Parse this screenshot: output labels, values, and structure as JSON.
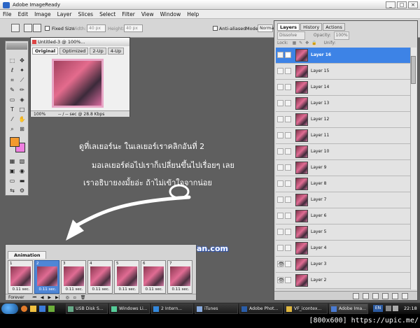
{
  "window": {
    "title": "Adobe ImageReady"
  },
  "menu": [
    "File",
    "Edit",
    "Image",
    "Layer",
    "Slices",
    "Select",
    "Filter",
    "View",
    "Window",
    "Help"
  ],
  "options": {
    "fixed_size": "Fixed Size",
    "width_label": "Width:",
    "width_value": "40 px",
    "height_label": "Height:",
    "height_value": "40 px",
    "anti_aliased": "Anti-aliased",
    "mode_label": "Mode:",
    "mode_value": "Norma"
  },
  "document": {
    "title": "Untitled-3 @ 100%...",
    "tabs": [
      "Original",
      "Optimized",
      "2-Up",
      "4-Up"
    ],
    "zoom": "100%",
    "status": "-- / -- sec @ 28.8 Kbps"
  },
  "caption": {
    "line1": "ดูที่เลเยอร์นะ ในเลเยอร์เราคลิกอันที่ 2",
    "line2": "มอเลเยอร์ต่อไปเราก็เปลี่ยนขึ้นไปเรื่อยๆ เลย",
    "line3": "เราอธิบายงงมั้ยอ่ะ ถ้าไม่เข้าใจจากน่อย",
    "credit": "Credit P_Ploy www.fourfan.com"
  },
  "animation": {
    "tab": "Animation",
    "frames": [
      {
        "num": "1",
        "delay": "0.11 sec.",
        "selected": false
      },
      {
        "num": "2",
        "delay": "0.11 sec.",
        "selected": true
      },
      {
        "num": "3",
        "delay": "0.11 sec.",
        "selected": false
      },
      {
        "num": "4",
        "delay": "0.11 sec.",
        "selected": false
      },
      {
        "num": "5",
        "delay": "0.11 sec.",
        "selected": false
      },
      {
        "num": "6",
        "delay": "0.11 sec.",
        "selected": false
      },
      {
        "num": "7",
        "delay": "0.11 sec.",
        "selected": false
      }
    ],
    "loop": "Forever"
  },
  "layers_panel": {
    "tabs": [
      "Layers",
      "History",
      "Actions"
    ],
    "blend": "Dissolve",
    "opacity_label": "Opacity:",
    "opacity_value": "100%",
    "lock_label": "Lock:",
    "unify_label": "Unify:",
    "layers": [
      {
        "name": "Layer 16",
        "selected": true,
        "eye": false
      },
      {
        "name": "Layer 15",
        "selected": false,
        "eye": false
      },
      {
        "name": "Layer 14",
        "selected": false,
        "eye": false
      },
      {
        "name": "Layer 13",
        "selected": false,
        "eye": false
      },
      {
        "name": "Layer 12",
        "selected": false,
        "eye": false
      },
      {
        "name": "Layer 11",
        "selected": false,
        "eye": false
      },
      {
        "name": "Layer 10",
        "selected": false,
        "eye": false
      },
      {
        "name": "Layer 9",
        "selected": false,
        "eye": false
      },
      {
        "name": "Layer 8",
        "selected": false,
        "eye": false
      },
      {
        "name": "Layer 7",
        "selected": false,
        "eye": false
      },
      {
        "name": "Layer 6",
        "selected": false,
        "eye": false
      },
      {
        "name": "Layer 5",
        "selected": false,
        "eye": false
      },
      {
        "name": "Layer 4",
        "selected": false,
        "eye": false
      },
      {
        "name": "Layer 3",
        "selected": false,
        "eye": true
      },
      {
        "name": "Layer 2",
        "selected": false,
        "eye": true
      }
    ]
  },
  "taskbar": {
    "items": [
      "USB Disk S...",
      "Windows Li...",
      "2 Intern...",
      "iTunes",
      "Adobe Phot...",
      "VF_icontex...",
      "Adobe Ima..."
    ],
    "lang": "EN",
    "clock": "22:18"
  },
  "watermark": "[800x600] https://upic.me/"
}
